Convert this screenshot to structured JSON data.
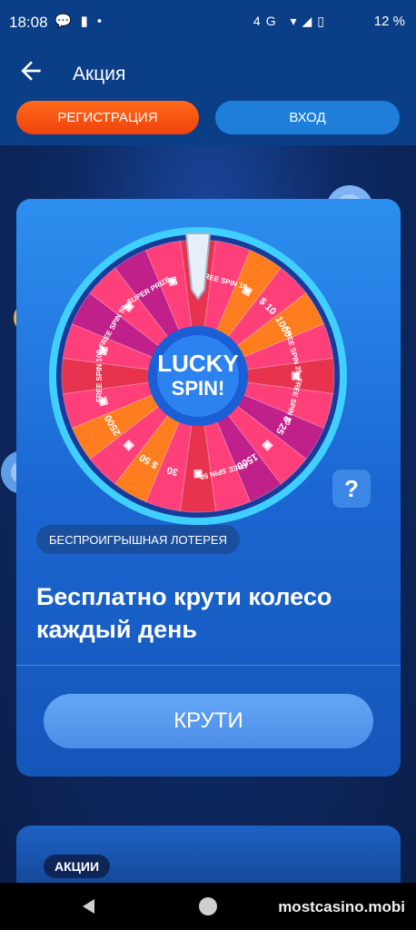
{
  "status": {
    "time": "18:08",
    "battery": "12 %",
    "network": "4G"
  },
  "appbar": {
    "title": "Акция",
    "register": "РЕГИСТРАЦИЯ",
    "login": "ВХОД"
  },
  "wheel": {
    "logo_top": "LUCKY",
    "logo_bottom": "SPIN!",
    "segments": [
      "100",
      "FREE SPIN 10",
      "",
      "$ 10",
      "1000",
      "FREE SPIN 25",
      "",
      "FREE SPIN 20",
      "$ 25",
      "",
      "1500",
      "FREE SPIN 50",
      "",
      "30",
      "$ 50",
      "",
      "2500",
      "",
      "FREE SPIN 100",
      "",
      "FREE SPIN 50",
      "",
      "SUPER PRIZE",
      ""
    ]
  },
  "help": "?",
  "promo": {
    "badge": "БЕСПРОИГРЫШНАЯ ЛОТЕРЕЯ",
    "headline": "Бесплатно крути колесо каждый день",
    "button": "КРУТИ"
  },
  "section2": {
    "badge": "АКЦИИ"
  },
  "watermark": "mostcasino.mobi",
  "colors": {
    "accent": "#f0420c",
    "primary": "#1e7ed8",
    "card": "#1b67d2"
  }
}
